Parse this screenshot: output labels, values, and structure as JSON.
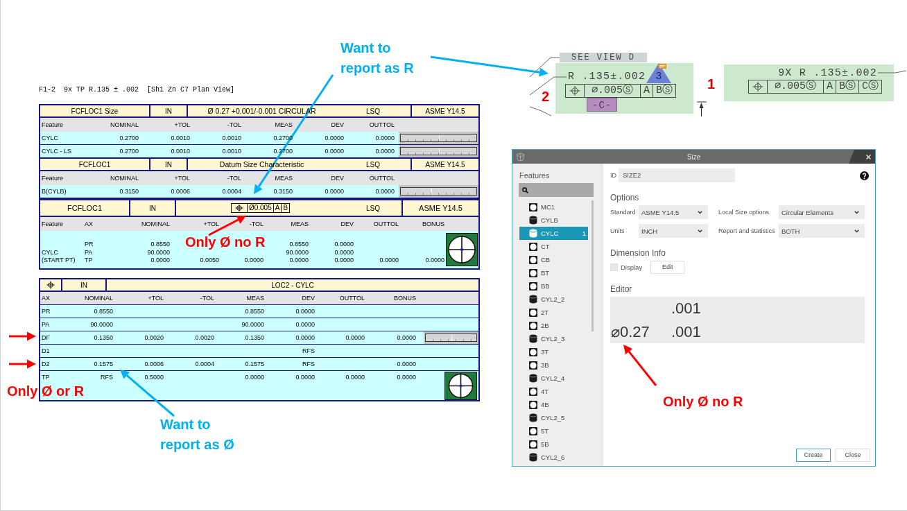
{
  "report": {
    "caption": "F1-2  9x TP R.135 ± .002  [Sh1 Zn C7 Plan View]",
    "size_tables": [
      {
        "header": {
          "name": "FCFLOC1 Size",
          "units": "IN",
          "spec": "Ø 0.27 +0.001/-0.001 CIRCULAR",
          "fit": "LSQ",
          "standard": "ASME Y14.5"
        },
        "columns": [
          "Feature",
          "NOMINAL",
          "+TOL",
          "-TOL",
          "MEAS",
          "DEV",
          "OUTTOL"
        ],
        "rows": [
          {
            "feature": "CYLC",
            "nominal": "0.2700",
            "plus_tol": "0.0010",
            "minus_tol": "0.0010",
            "meas": "0.2700",
            "dev": "0.0000",
            "outtol": "0.0000",
            "level": 0.5
          },
          {
            "feature": "CYLC - LS",
            "nominal": "0.2700",
            "plus_tol": "0.0010",
            "minus_tol": "0.0010",
            "meas": "0.2700",
            "dev": "0.0000",
            "outtol": "0.0000",
            "level": 0.5
          }
        ]
      },
      {
        "header": {
          "name": "FCFLOC1",
          "units": "IN",
          "spec": "Datum Size Characteristic",
          "fit": "LSQ",
          "standard": "ASME Y14.5"
        },
        "columns": [
          "Feature",
          "NOMINAL",
          "+TOL",
          "-TOL",
          "MEAS",
          "DEV",
          "OUTTOL"
        ],
        "rows": [
          {
            "feature": "B(CYLB)",
            "nominal": "0.3150",
            "plus_tol": "0.0006",
            "minus_tol": "0.0004",
            "meas": "0.3150",
            "dev": "0.0000",
            "outtol": "0.0000",
            "level": 0.4
          }
        ]
      }
    ],
    "position_table": {
      "header": {
        "name": "FCFLOC1",
        "units": "IN",
        "frame": {
          "tolerance": "Ø0.005",
          "datums": [
            "A",
            "B"
          ]
        },
        "fit": "LSQ",
        "standard": "ASME Y14.5"
      },
      "columns": [
        "Feature",
        "AX",
        "NOMINAL",
        "+TOL",
        "-TOL",
        "MEAS",
        "DEV",
        "OUTTOL",
        "BONUS"
      ],
      "rows": [
        {
          "ax": "PR",
          "nominal": "0.8550",
          "meas": "0.8550",
          "dev": "0.0000"
        },
        {
          "feature": "CYLC",
          "ax": "PA",
          "nominal": "90.0000",
          "meas": "90.0000",
          "dev": "0.0000"
        },
        {
          "feature": "(START PT)",
          "ax": "TP",
          "nominal": "0.0000",
          "plus_tol": "0.0050",
          "minus_tol": "0.0000",
          "meas": "0.0000",
          "dev": "0.0000",
          "outtol": "0.0000",
          "bonus": "0.0000"
        }
      ]
    },
    "location_table": {
      "header": {
        "units": "IN",
        "title": "LOC2 - CYLC"
      },
      "columns": [
        "AX",
        "NOMINAL",
        "+TOL",
        "-TOL",
        "MEAS",
        "DEV",
        "OUTTOL",
        "BONUS"
      ],
      "rows": [
        {
          "kind": "plain",
          "ax": "PR",
          "nominal": "0.8550",
          "meas": "0.8550",
          "dev": "0.0000"
        },
        {
          "kind": "plain",
          "ax": "PA",
          "nominal": "90.0000",
          "meas": "90.0000",
          "dev": "0.0000"
        },
        {
          "kind": "gauge",
          "level": 0.5,
          "ax": "DF",
          "nominal": "0.1350",
          "plus_tol": "0.0020",
          "minus_tol": "0.0020",
          "meas": "0.1350",
          "dev": "0.0000",
          "outtol": "0.0000",
          "bonus": "0.0000"
        },
        {
          "kind": "plain",
          "ax": "D1",
          "dev": "RFS"
        },
        {
          "kind": "plain",
          "ax": "D2",
          "nominal": "0.1575",
          "plus_tol": "0.0006",
          "minus_tol": "0.0004",
          "meas": "0.1575",
          "dev": "RFS",
          "bonus": "0.0000"
        },
        {
          "kind": "target",
          "ax": "TP",
          "nominal": "RFS",
          "plus_tol": "0.5000",
          "meas": "0.0000",
          "dev": "0.0000",
          "outtol": "0.0000",
          "bonus": "0.0000"
        }
      ]
    }
  },
  "drawing": {
    "view_tag": "SEE VIEW D",
    "callouts": [
      {
        "number": "2",
        "dimension": "R .135±.002",
        "revision": "3",
        "frame": [
          "⌀.005Ⓢ",
          "A",
          "BⓈ"
        ],
        "datum_tag": "-C-"
      },
      {
        "number": "1",
        "dimension": "9X R .135±.002",
        "frame": [
          "⌀.005Ⓢ",
          "A",
          "BⓈ",
          "CⓈ"
        ]
      }
    ]
  },
  "dialog": {
    "title": "Size",
    "features": {
      "label": "Features",
      "items": [
        {
          "name": "MC1",
          "kind": "circle",
          "selected": false
        },
        {
          "name": "CYLB",
          "kind": "cylinder",
          "selected": false
        },
        {
          "name": "CYLC",
          "kind": "cylinder",
          "selected": true,
          "badge": "1"
        },
        {
          "name": "CT",
          "kind": "circle",
          "selected": false
        },
        {
          "name": "CB",
          "kind": "circle",
          "selected": false
        },
        {
          "name": "BT",
          "kind": "circle",
          "selected": false
        },
        {
          "name": "BB",
          "kind": "circle",
          "selected": false
        },
        {
          "name": "CYL2_2",
          "kind": "cylinder",
          "selected": false
        },
        {
          "name": "2T",
          "kind": "circle",
          "selected": false
        },
        {
          "name": "2B",
          "kind": "circle",
          "selected": false
        },
        {
          "name": "CYL2_3",
          "kind": "cylinder",
          "selected": false
        },
        {
          "name": "3T",
          "kind": "circle",
          "selected": false
        },
        {
          "name": "3B",
          "kind": "circle",
          "selected": false
        },
        {
          "name": "CYL2_4",
          "kind": "cylinder",
          "selected": false
        },
        {
          "name": "4T",
          "kind": "circle",
          "selected": false
        },
        {
          "name": "4B",
          "kind": "circle",
          "selected": false
        },
        {
          "name": "CYL2_5",
          "kind": "cylinder",
          "selected": false
        },
        {
          "name": "5T",
          "kind": "circle",
          "selected": false
        },
        {
          "name": "5B",
          "kind": "circle",
          "selected": false
        },
        {
          "name": "CYL2_6",
          "kind": "cylinder",
          "selected": false
        }
      ]
    },
    "id": {
      "label": "ID",
      "value": "SIZE2"
    },
    "options": {
      "title": "Options",
      "fields": [
        {
          "label": "Standard",
          "value": "ASME Y14.5"
        },
        {
          "label": "Local Size options",
          "value": "Circular Elements"
        },
        {
          "label": "Units",
          "value": "INCH"
        },
        {
          "label": "Report and statistics",
          "value": "BOTH"
        }
      ]
    },
    "dimension_info": {
      "title": "Dimension Info",
      "display": {
        "label": "Display",
        "checked": false
      },
      "edit_button": "Edit"
    },
    "editor": {
      "title": "Editor",
      "upper": ".001",
      "nominal": "⌀0.27",
      "lower": ".001"
    },
    "buttons": [
      {
        "label": "Create",
        "kind": "primary"
      },
      {
        "label": "Close",
        "kind": "secondary"
      }
    ]
  },
  "notes": [
    {
      "text": "Want to report as R",
      "color": "#00b0f0"
    },
    {
      "text": "Only Ø no R",
      "color": "#ff0000"
    },
    {
      "text": "Only Ø or R",
      "color": "#ff0000"
    },
    {
      "text": "Want to report as Ø",
      "color": "#00b0f0"
    },
    {
      "text": "Only Ø no R",
      "color": "#ff0000"
    }
  ]
}
